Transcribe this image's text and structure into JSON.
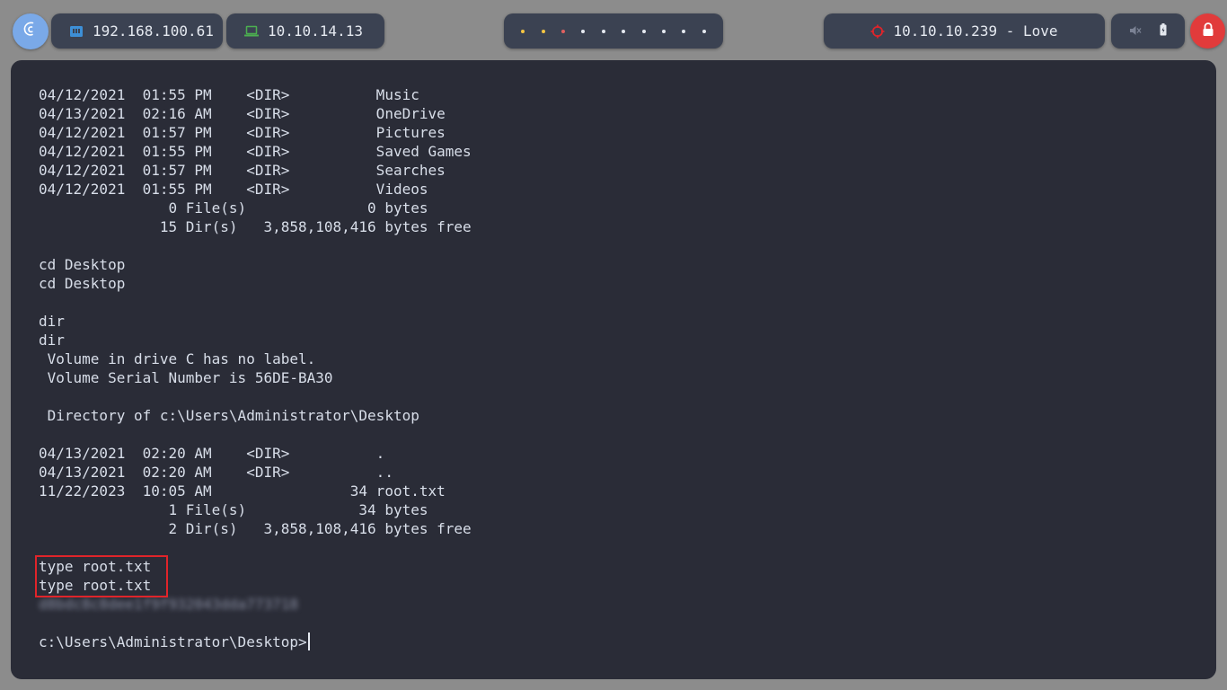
{
  "topbar": {
    "host_ip": "192.168.100.61",
    "vpn_ip": "10.10.14.13",
    "target_label": "10.10.10.239 - Love",
    "workspace_dots": [
      "#f5c542",
      "#f5c542",
      "#e06060",
      "#e5e9f0",
      "#e5e9f0",
      "#e5e9f0",
      "#e5e9f0",
      "#e5e9f0",
      "#e5e9f0",
      "#e5e9f0"
    ],
    "icons": {
      "logo": "debian-swirl-icon",
      "host": "network-card-icon",
      "vpn": "laptop-icon",
      "target": "crosshair-icon",
      "mute": "speaker-muted-icon",
      "battery": "battery-icon",
      "lock": "lock-icon"
    },
    "colors": {
      "accent_blue": "#3d8fd6",
      "accent_green": "#4caf50",
      "target_red": "#e0242a",
      "lock_bg": "#e13b3b"
    }
  },
  "terminal": {
    "lines": [
      "04/12/2021  01:55 PM    <DIR>          Music",
      "04/13/2021  02:16 AM    <DIR>          OneDrive",
      "04/12/2021  01:57 PM    <DIR>          Pictures",
      "04/12/2021  01:55 PM    <DIR>          Saved Games",
      "04/12/2021  01:57 PM    <DIR>          Searches",
      "04/12/2021  01:55 PM    <DIR>          Videos",
      "               0 File(s)              0 bytes",
      "              15 Dir(s)   3,858,108,416 bytes free",
      "",
      "cd Desktop",
      "cd Desktop",
      "",
      "dir",
      "dir",
      " Volume in drive C has no label.",
      " Volume Serial Number is 56DE-BA30",
      "",
      " Directory of c:\\Users\\Administrator\\Desktop",
      "",
      "04/13/2021  02:20 AM    <DIR>          .",
      "04/13/2021  02:20 AM    <DIR>          ..",
      "11/22/2023  10:05 AM                34 root.txt",
      "               1 File(s)             34 bytes",
      "               2 Dir(s)   3,858,108,416 bytes free",
      "",
      "type root.txt",
      "type root.txt",
      "d8bdc8c8dee1f9f932043dda773718",
      "",
      "c:\\Users\\Administrator\\Desktop>"
    ],
    "blurred_line_index": 27,
    "prompt_line_index": 29,
    "highlight_color": "#e0242a"
  }
}
